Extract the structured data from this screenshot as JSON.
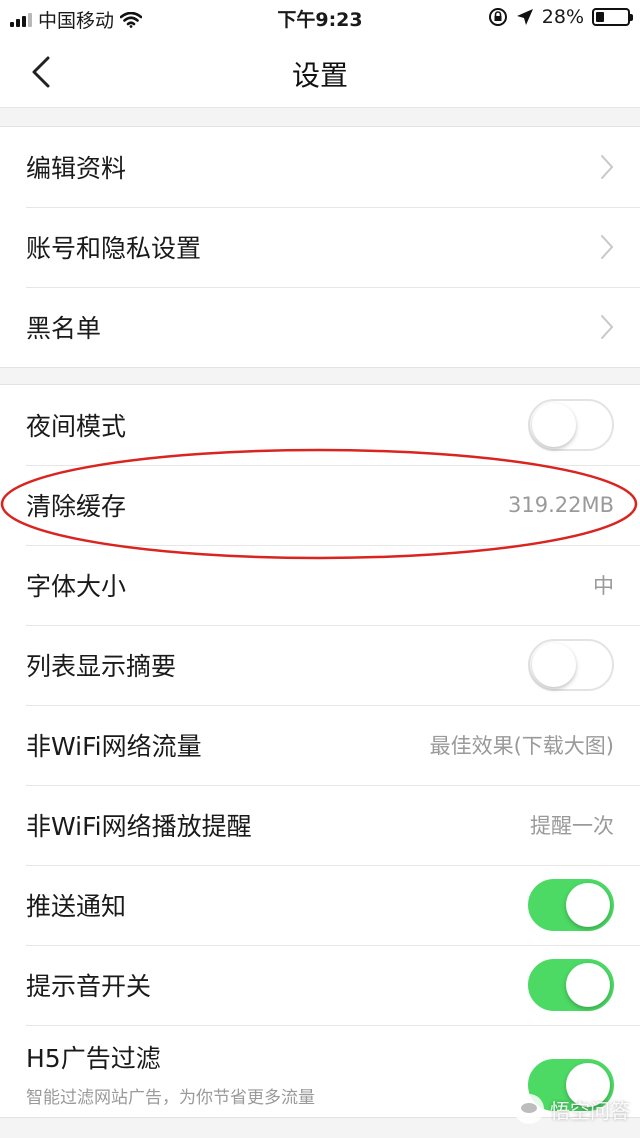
{
  "status_bar": {
    "carrier": "中国移动",
    "time": "下午9:23",
    "battery": "28%",
    "battery_level": 0.28
  },
  "nav": {
    "title": "设置",
    "back_icon": "chevron-left-icon"
  },
  "group1": {
    "items": [
      {
        "label": "编辑资料"
      },
      {
        "label": "账号和隐私设置"
      },
      {
        "label": "黑名单"
      }
    ]
  },
  "group2": {
    "night_mode": {
      "label": "夜间模式",
      "on": false
    },
    "clear_cache": {
      "label": "清除缓存",
      "value": "319.22MB"
    },
    "font_size": {
      "label": "字体大小",
      "value": "中"
    },
    "list_summary": {
      "label": "列表显示摘要",
      "on": false
    },
    "non_wifi_traffic": {
      "label": "非WiFi网络流量",
      "value": "最佳效果(下载大图)"
    },
    "non_wifi_play": {
      "label": "非WiFi网络播放提醒",
      "value": "提醒一次"
    },
    "push": {
      "label": "推送通知",
      "on": true
    },
    "sound": {
      "label": "提示音开关",
      "on": true
    },
    "ad_filter": {
      "label": "H5广告过滤",
      "sub": "智能过滤网站广告，为你节省更多流量",
      "on": true
    }
  },
  "watermark": {
    "text": "悟空问答"
  },
  "colors": {
    "toggle_on": "#4cd964",
    "annotation": "#d9241f",
    "background": "#f4f4f4"
  }
}
